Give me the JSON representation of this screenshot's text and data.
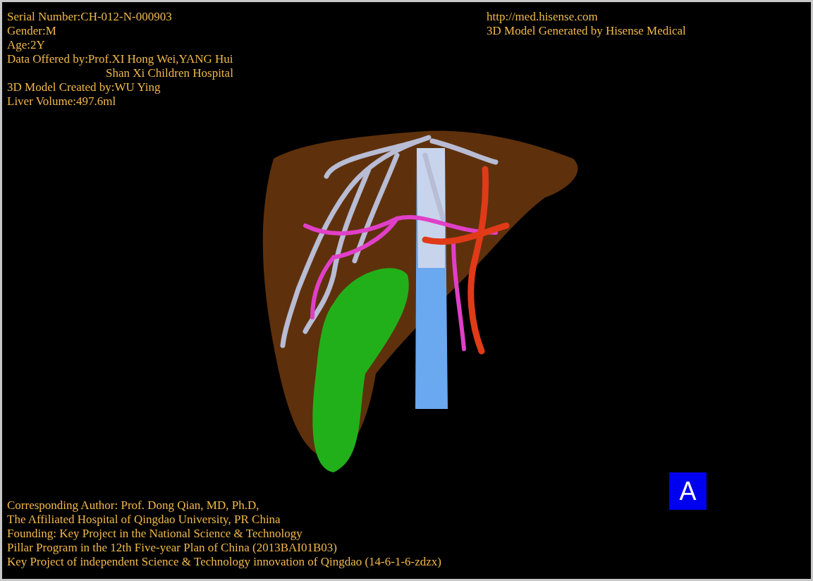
{
  "header_left": [
    {
      "text": "Serial Number:CH-012-N-000903",
      "indented": false
    },
    {
      "text": "Gender:M",
      "indented": false
    },
    {
      "text": "Age:2Y",
      "indented": false
    },
    {
      "text": "Data Offered by:Prof.XI Hong Wei,YANG Hui",
      "indented": false
    },
    {
      "text": "Shan Xi Children Hospital",
      "indented": true
    },
    {
      "text": "3D Model Created by:WU Ying",
      "indented": false
    },
    {
      "text": "Liver Volume:497.6ml",
      "indented": false
    }
  ],
  "header_right": [
    "http://med.hisense.com",
    "3D Model Generated by Hisense Medical"
  ],
  "credits": [
    "Corresponding Author: Prof. Dong Qian, MD, Ph.D,",
    "The Affiliated Hospital of Qingdao University, PR China",
    "Founding: Key Project in the National Science & Technology",
    "Pillar Program in the 12th Five-year Plan of China (2013BAI01B03)",
    "Key Project of independent Science & Technology innovation of Qingdao (14-6-1-6-zdzx)"
  ],
  "view_label": "A"
}
